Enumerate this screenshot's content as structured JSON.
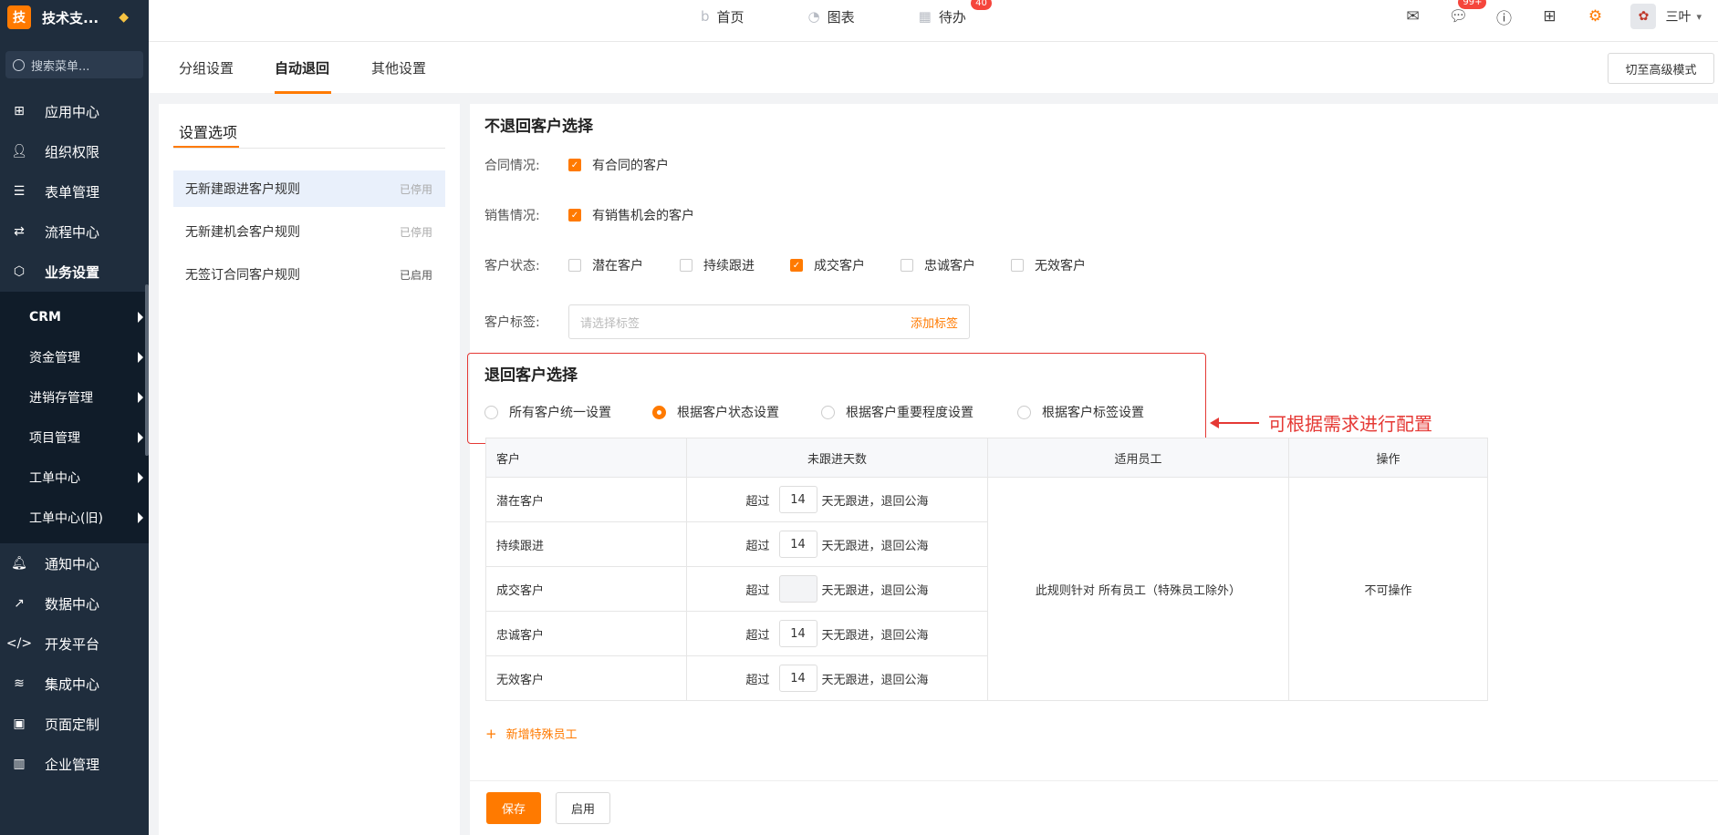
{
  "app": {
    "logo_char": "技",
    "title": "技术支..."
  },
  "sidebar": {
    "search_placeholder": "搜索菜单...",
    "items": [
      {
        "label": "应用中心",
        "icon": "apps-icon"
      },
      {
        "label": "组织权限",
        "icon": "user-icon"
      },
      {
        "label": "表单管理",
        "icon": "form-icon"
      },
      {
        "label": "流程中心",
        "icon": "flow-icon"
      },
      {
        "label": "业务设置",
        "icon": "cube-icon"
      }
    ],
    "sub_items": [
      {
        "label": "CRM"
      },
      {
        "label": "资金管理"
      },
      {
        "label": "进销存管理"
      },
      {
        "label": "项目管理"
      },
      {
        "label": "工单中心"
      },
      {
        "label": "工单中心(旧)"
      }
    ],
    "items_bottom": [
      {
        "label": "通知中心",
        "icon": "bell-icon"
      },
      {
        "label": "数据中心",
        "icon": "chart-icon"
      },
      {
        "label": "开发平台",
        "icon": "code-icon"
      },
      {
        "label": "集成中心",
        "icon": "layers-icon"
      },
      {
        "label": "页面定制",
        "icon": "layout-icon"
      },
      {
        "label": "企业管理",
        "icon": "building-icon"
      }
    ]
  },
  "topnav": {
    "home": "首页",
    "charts": "图表",
    "todo": "待办",
    "todo_badge": "40",
    "msg_badge": "99+",
    "user_name": "三叶"
  },
  "tabs": {
    "group": "分组设置",
    "auto_return": "自动退回",
    "other": "其他设置",
    "advanced_mode": "切至高级模式"
  },
  "left_panel": {
    "title": "设置选项",
    "rules": [
      {
        "label": "无新建跟进客户规则",
        "status": "已停用"
      },
      {
        "label": "无新建机会客户规则",
        "status": "已停用"
      },
      {
        "label": "无签订合同客户规则",
        "status": "已启用"
      }
    ]
  },
  "no_return": {
    "title": "不退回客户选择",
    "contract_label": "合同情况:",
    "contract_option": "有合同的客户",
    "sales_label": "销售情况:",
    "sales_option": "有销售机会的客户",
    "status_label": "客户状态:",
    "statuses": [
      "潜在客户",
      "持续跟进",
      "成交客户",
      "忠诚客户",
      "无效客户"
    ],
    "tag_label": "客户标签:",
    "tag_placeholder": "请选择标签",
    "tag_add": "添加标签"
  },
  "return": {
    "title": "退回客户选择",
    "options": [
      "所有客户统一设置",
      "根据客户状态设置",
      "根据客户重要程度设置",
      "根据客户标签设置"
    ],
    "annotation": "可根据需求进行配置"
  },
  "table": {
    "headers": [
      "客户",
      "未跟进天数",
      "适用员工",
      "操作"
    ],
    "prefix": "超过",
    "suffix": "天无跟进，退回公海",
    "rows": [
      {
        "customer": "潜在客户",
        "days": "14"
      },
      {
        "customer": "持续跟进",
        "days": "14"
      },
      {
        "customer": "成交客户",
        "days": ""
      },
      {
        "customer": "忠诚客户",
        "days": "14"
      },
      {
        "customer": "无效客户",
        "days": "14"
      }
    ],
    "applies_to": "此规则针对 所有员工（特殊员工除外）",
    "operation": "不可操作",
    "add_special": "新增特殊员工"
  },
  "footer": {
    "save": "保存",
    "enable": "启用"
  },
  "colors": {
    "accent": "#ff7a00",
    "sidebar_bg": "#1f2d3d",
    "annotation": "#e53935"
  }
}
